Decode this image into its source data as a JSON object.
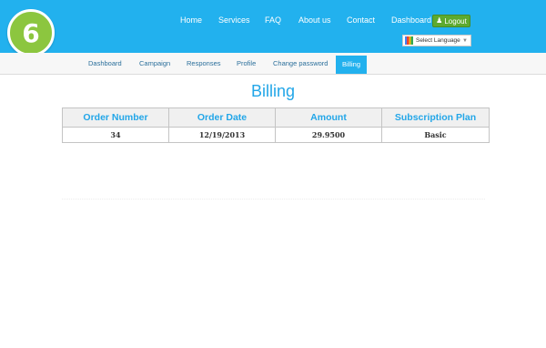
{
  "step_badge": "6",
  "top_nav": {
    "items": [
      "Home",
      "Services",
      "FAQ",
      "About us",
      "Contact",
      "Dashboard"
    ],
    "logout_label": "Logout",
    "language_label": "Select Language"
  },
  "sub_nav": {
    "items": [
      "Dashboard",
      "Campaign",
      "Responses",
      "Profile",
      "Change password",
      "Billing"
    ],
    "active": "Billing"
  },
  "page": {
    "title": "Billing"
  },
  "billing_table": {
    "columns": [
      "Order Number",
      "Order Date",
      "Amount",
      "Subscription Plan"
    ],
    "rows": [
      [
        "34",
        "12/19/2013",
        "29.9500",
        "Basic"
      ]
    ]
  },
  "colors": {
    "header_blue": "#22b1ee",
    "title_blue": "#22a6e8",
    "badge_green": "#8cc63f",
    "logout_green": "#5daa2f"
  }
}
